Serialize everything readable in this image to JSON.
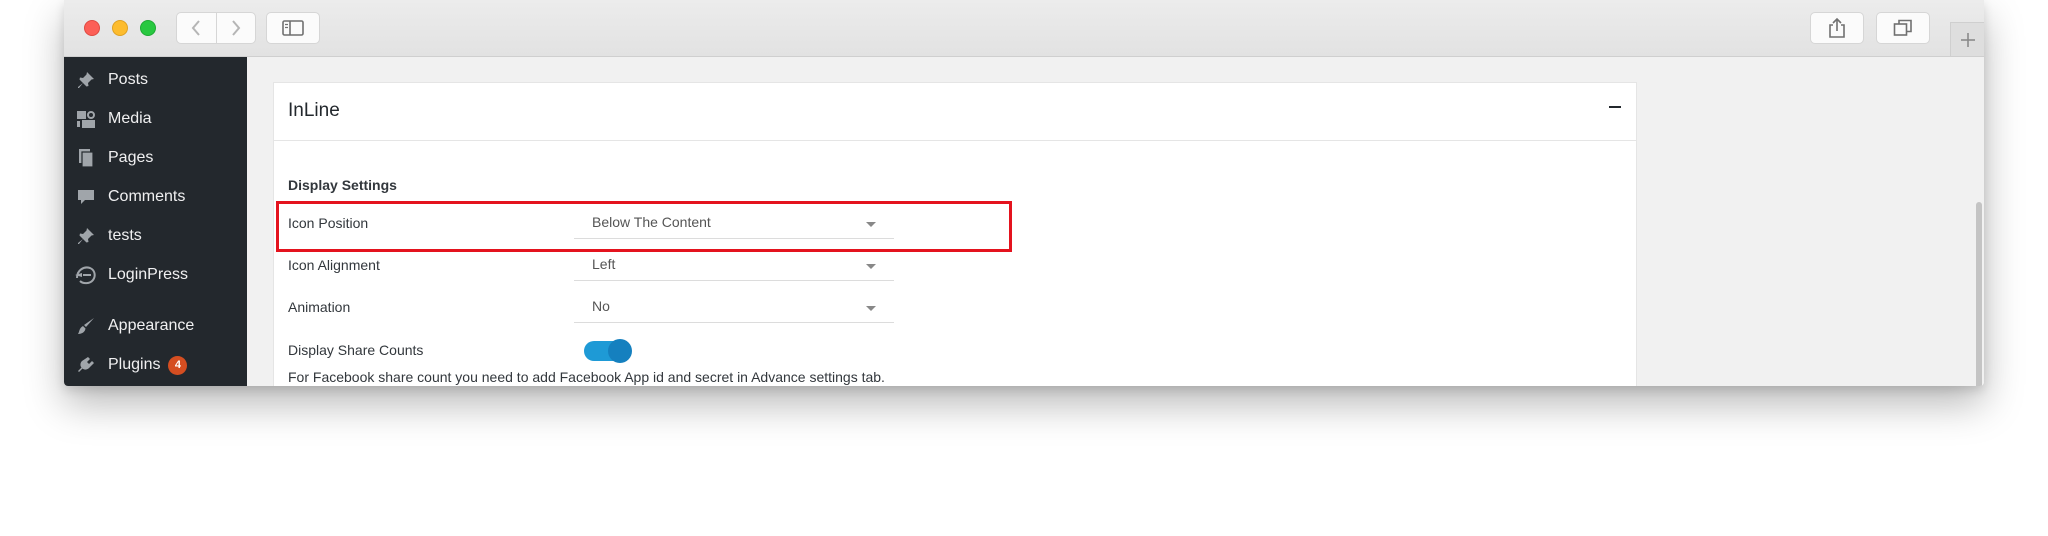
{
  "titlebar": {
    "back_icon": "chevron-left-icon",
    "forward_icon": "chevron-right-icon",
    "sidebar_icon": "sidebar-icon",
    "share_icon": "share-icon",
    "tabs_icon": "tabs-icon",
    "new_tab_icon": "plus-icon"
  },
  "sidebar": {
    "items": [
      {
        "label": "Posts",
        "icon": "pushpin-icon"
      },
      {
        "label": "Media",
        "icon": "media-icon"
      },
      {
        "label": "Pages",
        "icon": "pages-icon"
      },
      {
        "label": "Comments",
        "icon": "comment-icon"
      },
      {
        "label": "tests",
        "icon": "pushpin-icon"
      },
      {
        "label": "LoginPress",
        "icon": "loginpress-icon"
      },
      {
        "label": "Appearance",
        "icon": "paintbrush-icon"
      },
      {
        "label": "Plugins",
        "icon": "plug-icon",
        "badge": "4"
      }
    ]
  },
  "panel": {
    "title": "InLine",
    "section_title": "Display Settings",
    "rows": [
      {
        "label": "Icon Position",
        "value": "Below The Content"
      },
      {
        "label": "Icon Alignment",
        "value": "Left"
      },
      {
        "label": "Animation",
        "value": "No"
      }
    ],
    "share_counts_label": "Display Share Counts",
    "share_counts_enabled": true,
    "note": "For Facebook share count you need to add Facebook App id and secret in Advance settings tab."
  },
  "colors": {
    "sidebar_bg": "#23282d",
    "highlight": "#e4131e",
    "toggle": "#1e9ad6",
    "badge": "#d54e21"
  }
}
